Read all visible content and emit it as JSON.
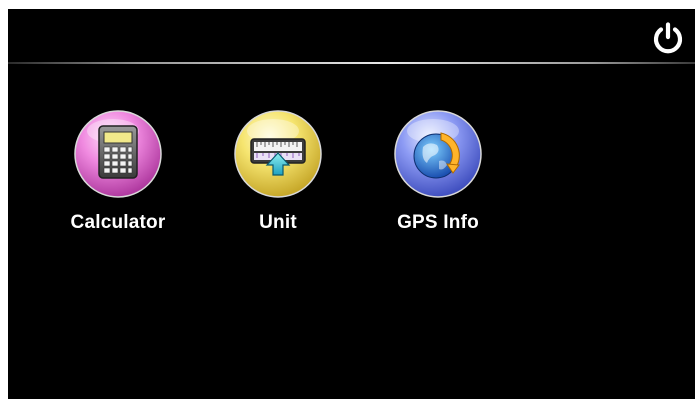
{
  "header": {
    "power_icon": "power-icon"
  },
  "apps": [
    {
      "label": "Calculator",
      "icon": "calculator-icon",
      "color": "#e87ad8"
    },
    {
      "label": "Unit",
      "icon": "ruler-icon",
      "color": "#f3e06a"
    },
    {
      "label": "GPS Info",
      "icon": "globe-icon",
      "color": "#7e8cf0"
    }
  ]
}
